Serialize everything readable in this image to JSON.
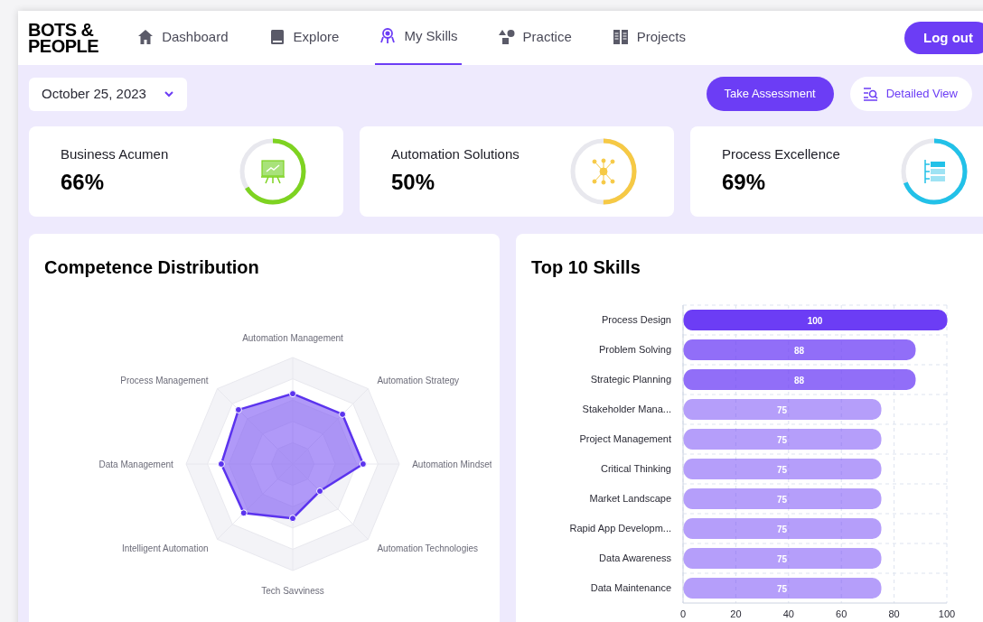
{
  "brand": {
    "line1": "BOTS &",
    "line2": "PEOPLE"
  },
  "nav": [
    {
      "label": "Dashboard",
      "selected": false
    },
    {
      "label": "Explore",
      "selected": false
    },
    {
      "label": "My Skills",
      "selected": true
    },
    {
      "label": "Practice",
      "selected": false
    },
    {
      "label": "Projects",
      "selected": false
    }
  ],
  "logout": "Log out",
  "date_select": {
    "value": "October 25, 2023"
  },
  "take_assessment": "Take Assessment",
  "detailed_view": "Detailed View",
  "stats": [
    {
      "title": "Business Acumen",
      "value": "66%",
      "level": 0.66,
      "color": "#7ed321"
    },
    {
      "title": "Automation Solutions",
      "value": "50%",
      "level": 0.5,
      "color": "#f6c945"
    },
    {
      "title": "Process Excellence",
      "value": "69%",
      "level": 0.69,
      "color": "#22c1e8"
    }
  ],
  "competence": {
    "title": "Competence Distribution",
    "axes": [
      "Automation Management",
      "Process Management",
      "Automation Strategy",
      "Data Management",
      "Automation Mindset",
      "Intelligent Automation",
      "Automation Technologies",
      "Tech Savviness"
    ]
  },
  "top_skills": {
    "title": "Top 10 Skills",
    "chart_data": {
      "type": "bar",
      "orientation": "horizontal",
      "categories": [
        "Process Design",
        "Problem Solving",
        "Strategic Planning",
        "Stakeholder Mana...",
        "Project Management",
        "Critical Thinking",
        "Market Landscape",
        "Rapid App Developm...",
        "Data Awareness",
        "Data Maintenance"
      ],
      "values": [
        100,
        88,
        88,
        75,
        75,
        75,
        75,
        75,
        75,
        75
      ],
      "xlim": [
        0,
        100
      ],
      "xticks": [
        0,
        20,
        40,
        60,
        80,
        100
      ],
      "grid": true,
      "data_labels": true
    }
  }
}
